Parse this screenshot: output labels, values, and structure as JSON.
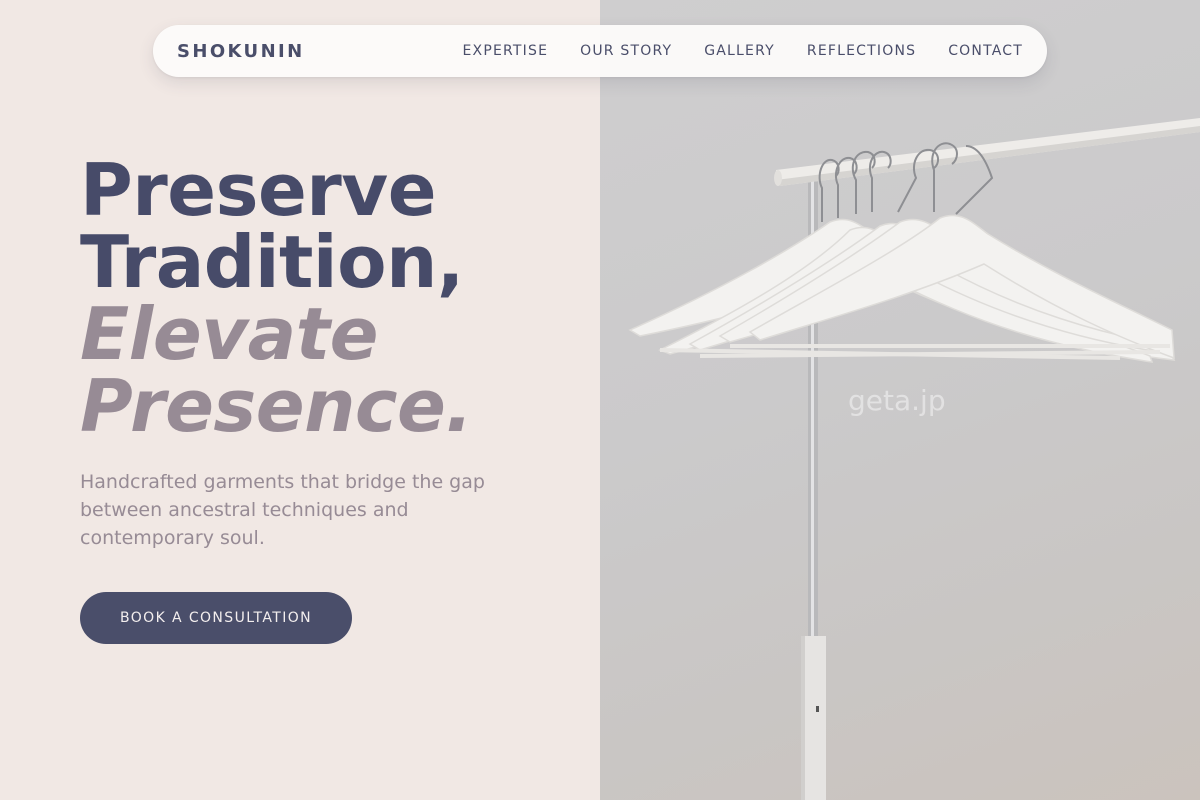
{
  "nav": {
    "brand": "SHOKUNIN",
    "links": [
      "EXPERTISE",
      "OUR STORY",
      "GALLERY",
      "REFLECTIONS",
      "CONTACT"
    ]
  },
  "hero": {
    "title_line1": "Preserve",
    "title_line2": "Tradition,",
    "title_line3": "Elevate",
    "title_line4": "Presence.",
    "subtitle": "Handcrafted garments that bridge the gap between ancestral techniques and contemporary soul.",
    "cta_label": "BOOK A CONSULTATION"
  },
  "image": {
    "subject": "white clothes hangers on garment rack",
    "watermark": "geta.jp"
  },
  "colors": {
    "background_left": "#f1e8e4",
    "primary": "#4a4e6a",
    "accent_muted": "#978b95",
    "navbar_bg": "#fcfbfa"
  }
}
